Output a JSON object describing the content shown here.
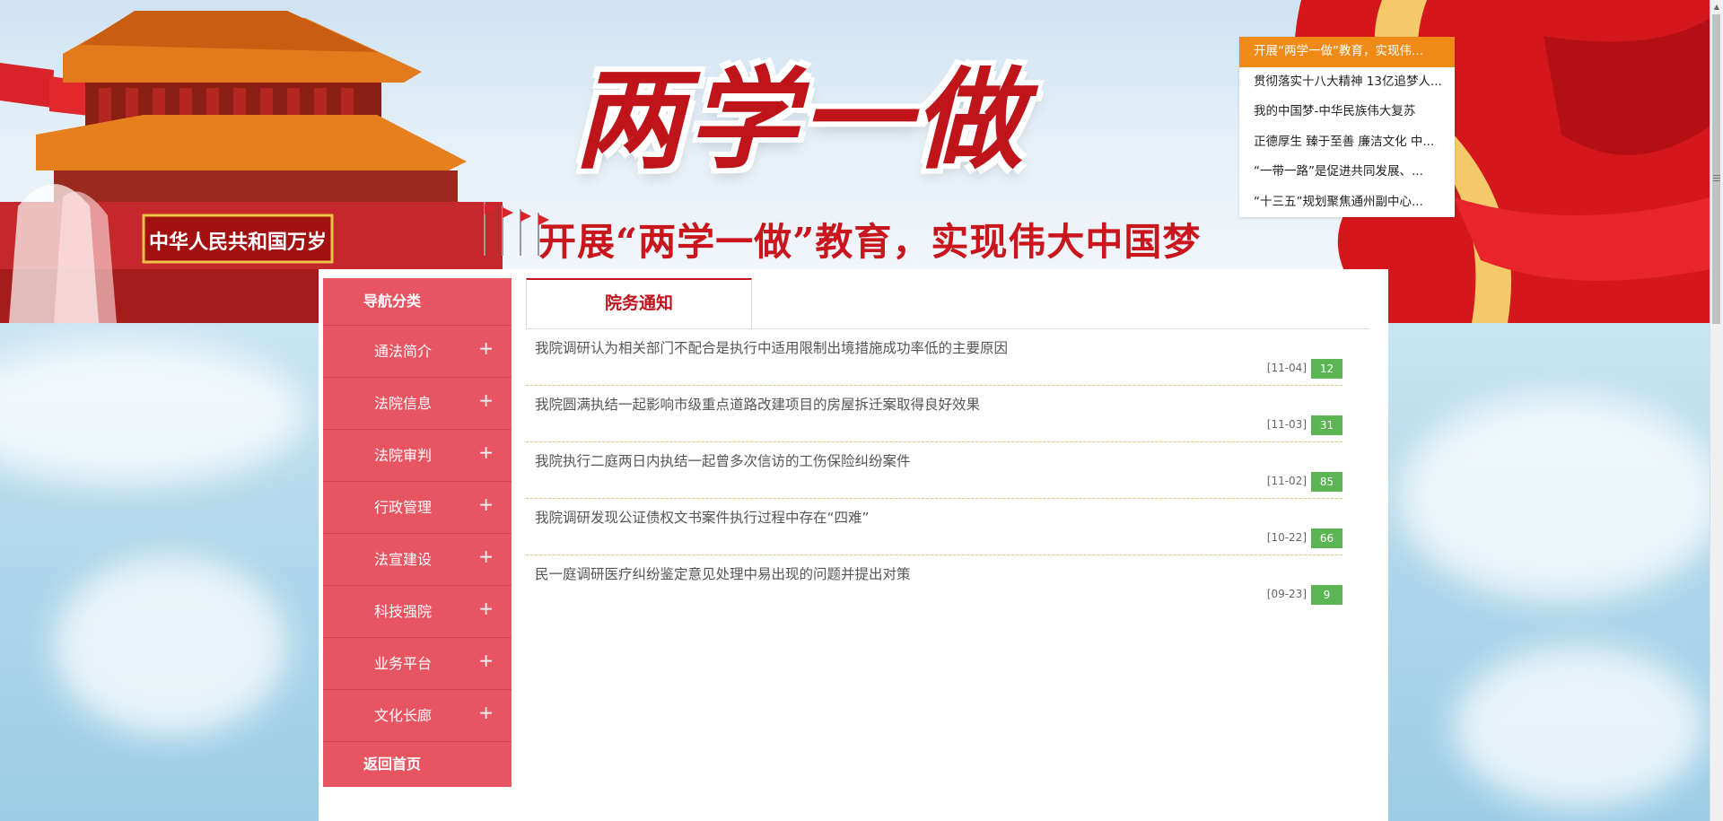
{
  "banner": {
    "title": "两学一做",
    "subtitle": "开展“两学一做”教育，实现伟大中国梦",
    "gate_sign": "中华人民共和国万岁"
  },
  "headlines": [
    "开展“两学一做”教育，实现伟...",
    "贯彻落实十八大精神 13亿追梦人...",
    "我的中国梦-中华民族伟大复苏",
    "正德厚生 臻于至善 廉洁文化 中...",
    "“一带一路”是促进共同发展、...",
    "“十三五”规划聚焦通州副中心..."
  ],
  "sidebar": {
    "header": "导航分类",
    "items": [
      {
        "label": "通法简介",
        "icon": "+"
      },
      {
        "label": "法院信息",
        "icon": "+"
      },
      {
        "label": "法院审判",
        "icon": "+"
      },
      {
        "label": "行政管理",
        "icon": "+"
      },
      {
        "label": "法宣建设",
        "icon": "+"
      },
      {
        "label": "科技强院",
        "icon": "+"
      },
      {
        "label": "业务平台",
        "icon": "+"
      },
      {
        "label": "文化长廊",
        "icon": "+"
      }
    ],
    "footer": "返回首页"
  },
  "content": {
    "tab": "院务通知",
    "news": [
      {
        "title": "我院调研认为相关部门不配合是执行中适用限制出境措施成功率低的主要原因",
        "date": "[11-04]",
        "count": "12"
      },
      {
        "title": "我院圆满执结一起影响市级重点道路改建项目的房屋拆迁案取得良好效果",
        "date": "[11-03]",
        "count": "31"
      },
      {
        "title": "我院执行二庭两日内执结一起曾多次信访的工伤保险纠纷案件",
        "date": "[11-02]",
        "count": "85"
      },
      {
        "title": "我院调研发现公证债权文书案件执行过程中存在“四难”",
        "date": "[10-22]",
        "count": "66"
      },
      {
        "title": "民一庭调研医疗纠纷鉴定意见处理中易出现的问题并提出对策",
        "date": "[09-23]",
        "count": "9"
      }
    ]
  },
  "colors": {
    "sidebar": "#e85562",
    "accent_red": "#c0151d",
    "headline_active": "#f08a16",
    "count_badge": "#5ab552"
  }
}
